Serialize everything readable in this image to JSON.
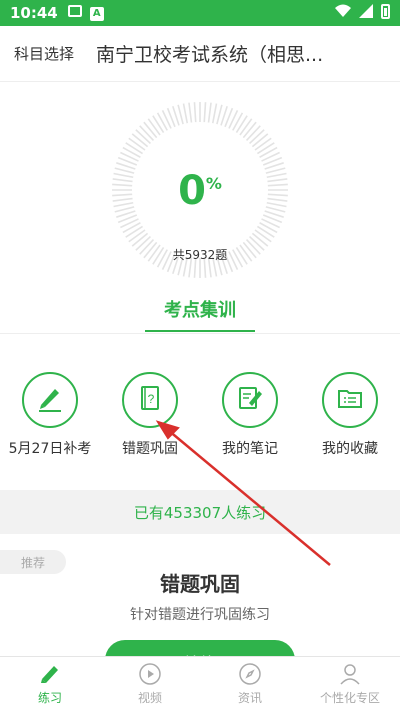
{
  "status_bar": {
    "time": "10:44"
  },
  "header": {
    "subject_label": "科目选择",
    "title": "南宁卫校考试系统（相思..."
  },
  "progress": {
    "percent_value": "0",
    "percent_sign": "%",
    "total_text": "共5932题",
    "completion": 0
  },
  "tabs": [
    {
      "label": "考点集训",
      "active": true
    }
  ],
  "quick_actions": [
    {
      "label": "5月27日补考",
      "icon": "pencil-icon"
    },
    {
      "label": "错题巩固",
      "icon": "question-book-icon"
    },
    {
      "label": "我的笔记",
      "icon": "note-edit-icon"
    },
    {
      "label": "我的收藏",
      "icon": "folder-icon"
    }
  ],
  "banner": {
    "text": "已有453307人练习"
  },
  "recommend": {
    "tag": "推荐",
    "title": "错题巩固",
    "description": "针对错题进行巩固练习",
    "button_label": "开始练习"
  },
  "bottom_nav": [
    {
      "label": "练习",
      "icon": "pencil-icon",
      "active": true
    },
    {
      "label": "视频",
      "icon": "play-icon",
      "active": false
    },
    {
      "label": "资讯",
      "icon": "compass-icon",
      "active": false
    },
    {
      "label": "个性化专区",
      "icon": "person-icon",
      "active": false
    }
  ],
  "colors": {
    "accent": "#2fb34b",
    "annotation_arrow": "#d9302c"
  }
}
